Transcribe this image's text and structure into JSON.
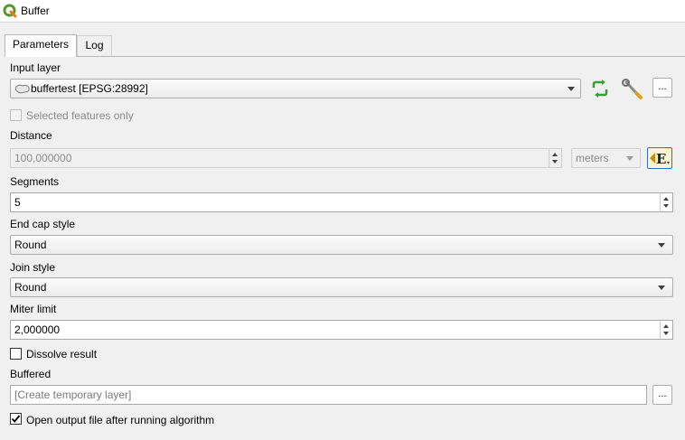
{
  "window": {
    "title": "Buffer"
  },
  "tabs": [
    {
      "label": "Parameters"
    },
    {
      "label": "Log"
    }
  ],
  "input_layer": {
    "label": "Input layer",
    "value": "buffertest [EPSG:28992]",
    "browse_label": "..."
  },
  "selected_only": {
    "label": "Selected features only",
    "checked": false
  },
  "distance": {
    "label": "Distance",
    "value": "100,000000",
    "unit": "meters"
  },
  "segments": {
    "label": "Segments",
    "value": "5"
  },
  "end_cap": {
    "label": "End cap style",
    "value": "Round"
  },
  "join_style": {
    "label": "Join style",
    "value": "Round"
  },
  "miter": {
    "label": "Miter limit",
    "value": "2,000000"
  },
  "dissolve": {
    "label": "Dissolve result",
    "checked": false
  },
  "buffered": {
    "label": "Buffered",
    "placeholder": "[Create temporary layer]",
    "browse_label": "..."
  },
  "open_output": {
    "label": "Open output file after running algorithm",
    "checked": true
  },
  "colors": {
    "accent": "#589632",
    "iterate_green": "#3aa033"
  }
}
